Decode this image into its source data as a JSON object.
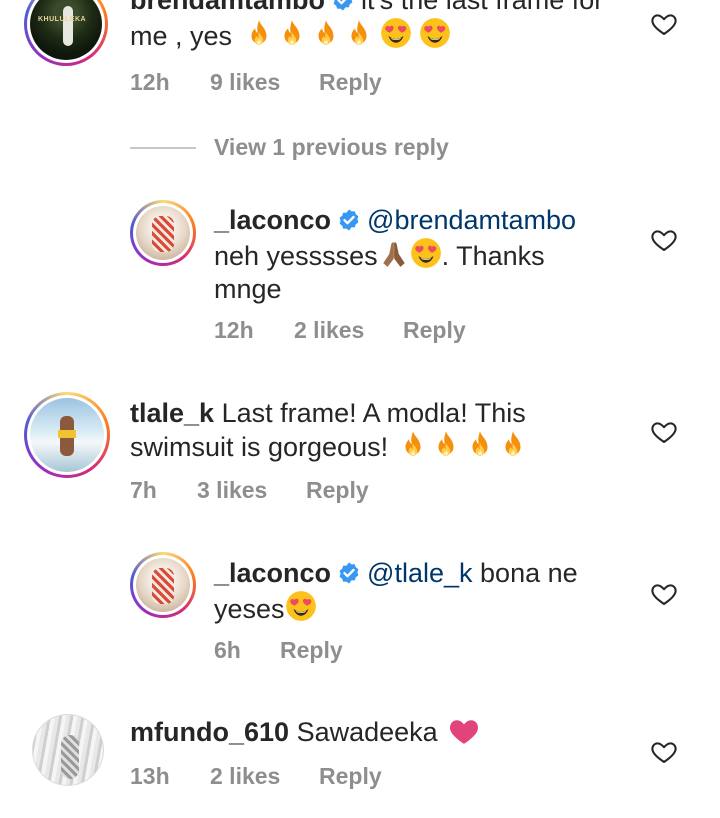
{
  "comments": [
    {
      "username": "brendamtambo",
      "verified": true,
      "text_line1": "it's the last frame for",
      "text_line2": "me , yes",
      "time": "12h",
      "likes": "9 likes",
      "reply": "Reply",
      "avatar_caption": "KHULULEKA"
    },
    {
      "username": "_laconco",
      "verified": true,
      "mention": "@brendamtambo",
      "text_line1": "neh yesssses",
      "text_line1b": ". Thanks",
      "text_line2": "mnge",
      "time": "12h",
      "likes": "2 likes",
      "reply": "Reply"
    },
    {
      "username": "tlale_k",
      "text_line1": "Last frame! A modla! This",
      "text_line2": "swimsuit is gorgeous!",
      "time": "7h",
      "likes": "3 likes",
      "reply": "Reply"
    },
    {
      "username": "_laconco",
      "verified": true,
      "mention": "@tlale_k",
      "text_line1": "bona ne",
      "text_line2": "yeses",
      "time": "6h",
      "reply": "Reply"
    },
    {
      "username": "mfundo_610",
      "text_line1": "Sawadeeka",
      "time": "13h",
      "likes": "2 likes",
      "reply": "Reply"
    }
  ],
  "view_previous": "View 1 previous reply",
  "icons": {
    "heart": "heart-outline-icon",
    "verified": "verified-badge-icon",
    "fire": "fire-emoji",
    "heart_eyes": "heart-eyes-emoji",
    "praying": "praying-hands-emoji",
    "pink_heart": "pink-heart-emoji"
  },
  "colors": {
    "text": "#262626",
    "meta": "#8e8e8e",
    "mention": "#00376b",
    "verified": "#3897f0",
    "pink_heart": "#e0447a"
  }
}
